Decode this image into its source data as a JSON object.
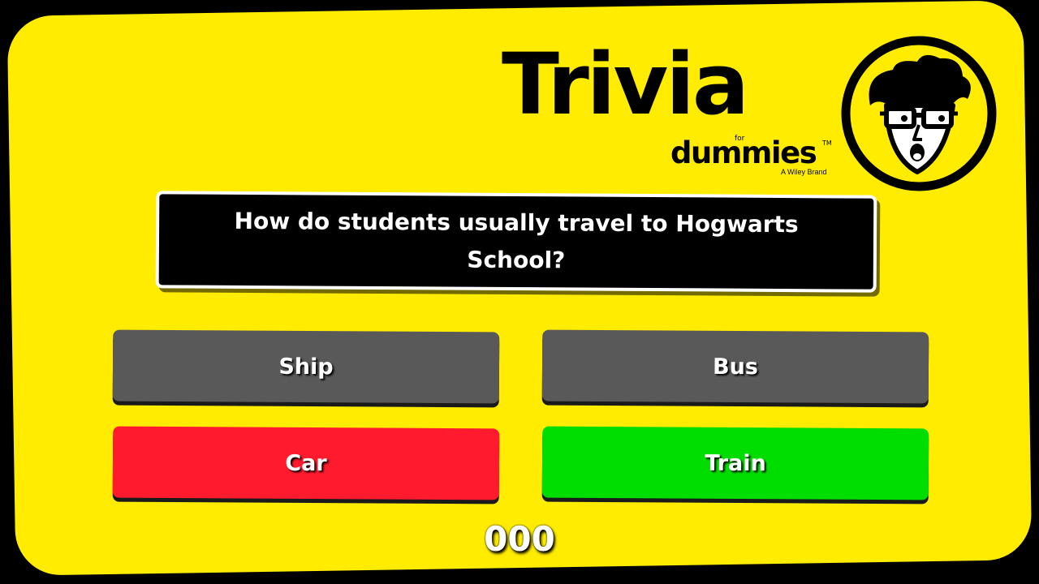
{
  "brand": {
    "title": "Trivia",
    "for": "for",
    "name": "dummies",
    "tm": "TM",
    "tagline": "A Wiley Brand",
    "mascot_icon": "dummies-mascot-icon"
  },
  "question": {
    "text": "How do students usually travel to Hogwarts School?"
  },
  "answers": [
    {
      "label": "Ship",
      "color": "#595959",
      "state": "neutral"
    },
    {
      "label": "Bus",
      "color": "#595959",
      "state": "neutral"
    },
    {
      "label": "Car",
      "color": "#FF1A2E",
      "state": "wrong"
    },
    {
      "label": "Train",
      "color": "#00DD00",
      "state": "correct"
    }
  ],
  "timer": "000",
  "colors": {
    "background": "#FFEC00",
    "frame": "#000000"
  }
}
